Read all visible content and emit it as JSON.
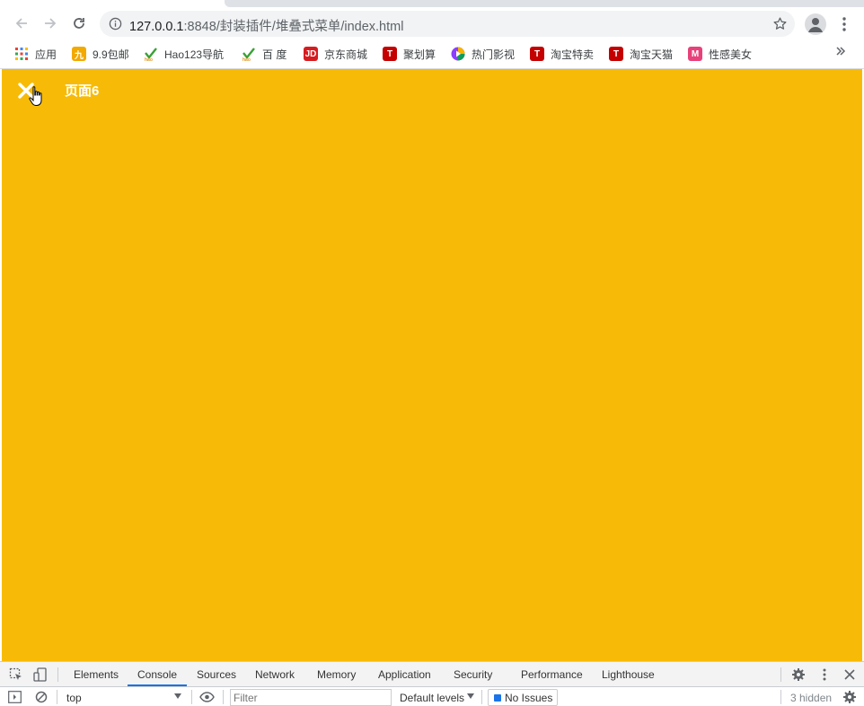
{
  "browser": {
    "url_host": "127.0.0.1",
    "url_rest": ":8848/封装插件/堆叠式菜单/index.html"
  },
  "bookmarks": [
    {
      "label": "应用",
      "icon": "apps-grid-icon",
      "color": "#4285f4"
    },
    {
      "label": "9.9包邮",
      "icon": "jiu-icon",
      "color": "#f2a900"
    },
    {
      "label": "Hao123导航",
      "icon": "hao-icon",
      "color": "#3aa035"
    },
    {
      "label": "百 度",
      "icon": "hao-icon",
      "color": "#3aa035"
    },
    {
      "label": "京东商城",
      "icon": "jd-icon",
      "color": "#d71c20"
    },
    {
      "label": "聚划算",
      "icon": "tmall-t-icon",
      "color": "#c40000"
    },
    {
      "label": "热门影视",
      "icon": "video-play-icon",
      "color": "#8a3ffc"
    },
    {
      "label": "淘宝特卖",
      "icon": "tmall-t-icon",
      "color": "#c40000"
    },
    {
      "label": "淘宝天猫",
      "icon": "tmall-t-icon",
      "color": "#c40000"
    },
    {
      "label": "性感美女",
      "icon": "m-icon",
      "color": "#e8407a"
    }
  ],
  "bookmark_icon_text": {
    "jd": "JD",
    "t": "T",
    "m": "M"
  },
  "page": {
    "title": "页面6",
    "background": "#f7bb07"
  },
  "devtools": {
    "tabs": [
      "Elements",
      "Console",
      "Sources",
      "Network",
      "Memory",
      "Application",
      "Security",
      "Performance",
      "Lighthouse"
    ],
    "active_tab": "Console",
    "context": "top",
    "filter_placeholder": "Filter",
    "levels": "Default levels",
    "issues": "No Issues",
    "hidden_count": "3 hidden"
  }
}
